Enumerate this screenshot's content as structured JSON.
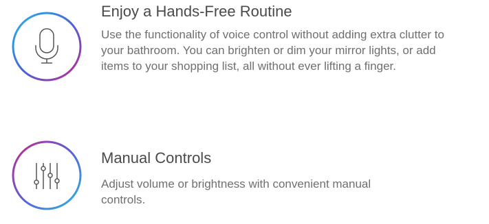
{
  "features": [
    {
      "icon": "microphone-icon",
      "title": "Enjoy a Hands-Free Routine",
      "description": "Use the functionality of voice control without adding extra clutter to your bathroom. You can brighten or dim your mirror lights, or add items to your shopping list, all without ever lifting a finger."
    },
    {
      "icon": "sliders-icon",
      "title": "Manual Controls",
      "description": "Adjust volume or brightness with convenient manual controls."
    }
  ],
  "colors": {
    "ring_start": "#27b7e6",
    "ring_mid": "#4a63d8",
    "ring_end": "#c02a8a",
    "icon_stroke": "#555555",
    "title": "#4a4a4a",
    "text": "#6f6f6f"
  }
}
